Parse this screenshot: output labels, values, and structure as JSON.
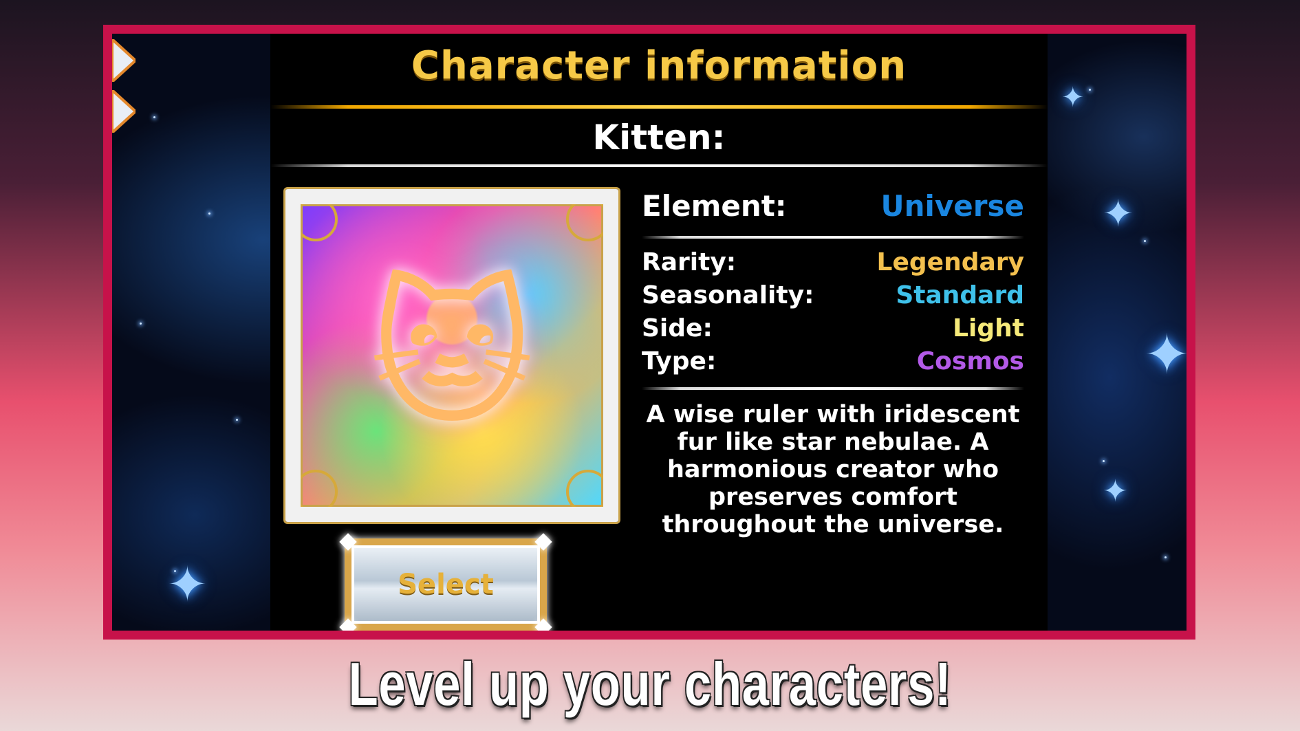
{
  "header": {
    "title": "Character information"
  },
  "character": {
    "name": "Kitten:",
    "portrait_icon": "kitten-portrait",
    "stats": [
      {
        "label": "Element:",
        "value": "Universe",
        "color": "#1a86e0"
      },
      {
        "label": "Rarity:",
        "value": "Legendary",
        "color": "#f3c04e"
      },
      {
        "label": "Seasonality:",
        "value": "Standard",
        "color": "#3fc1ea"
      },
      {
        "label": "Side:",
        "value": "Light",
        "color": "#f6ea7a"
      },
      {
        "label": "Type:",
        "value": "Cosmos",
        "color": "#b35ae8"
      }
    ],
    "description": "A wise ruler with iridescent fur like star nebulae. A harmonious creator who preserves comfort throughout the universe."
  },
  "actions": {
    "select_label": "Select"
  },
  "side_nav": {
    "icons": [
      "chevron-right-icon",
      "chevron-right-icon"
    ]
  },
  "banner": {
    "text": "Level up your characters!"
  },
  "colors": {
    "frame": "#c7124a",
    "title_gold": "#f6c947",
    "panel": "#000000"
  }
}
